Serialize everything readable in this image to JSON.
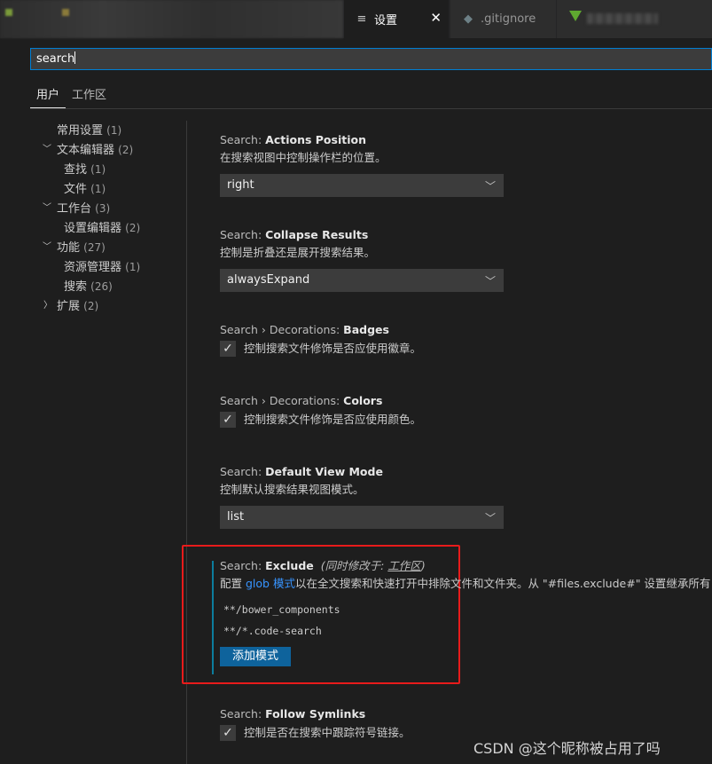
{
  "tabs": {
    "active_label": "设置",
    "inactive_label": ".gitignore",
    "close_glyph": "✕"
  },
  "search": {
    "value": "search"
  },
  "scope": {
    "user": "用户",
    "workspace": "工作区"
  },
  "toc": [
    {
      "label": "常用设置",
      "count": "(1)",
      "level": 0,
      "chevron": ""
    },
    {
      "label": "文本编辑器",
      "count": "(2)",
      "level": 0,
      "chevron": "down"
    },
    {
      "label": "查找",
      "count": "(1)",
      "level": 1,
      "chevron": ""
    },
    {
      "label": "文件",
      "count": "(1)",
      "level": 1,
      "chevron": ""
    },
    {
      "label": "工作台",
      "count": "(3)",
      "level": 0,
      "chevron": "down"
    },
    {
      "label": "设置编辑器",
      "count": "(2)",
      "level": 1,
      "chevron": ""
    },
    {
      "label": "功能",
      "count": "(27)",
      "level": 0,
      "chevron": "down"
    },
    {
      "label": "资源管理器",
      "count": "(1)",
      "level": 1,
      "chevron": ""
    },
    {
      "label": "搜索",
      "count": "(26)",
      "level": 1,
      "chevron": ""
    },
    {
      "label": "扩展",
      "count": "(2)",
      "level": 0,
      "chevron": "right"
    }
  ],
  "settings": {
    "actions_position": {
      "category": "Search: ",
      "name": "Actions Position",
      "description": "在搜索视图中控制操作栏的位置。",
      "value": "right"
    },
    "collapse_results": {
      "category": "Search: ",
      "name": "Collapse Results",
      "description": "控制是折叠还是展开搜索结果。",
      "value": "alwaysExpand"
    },
    "decorations_badges": {
      "category": "Search › Decorations: ",
      "name": "Badges",
      "description": "控制搜索文件修饰是否应使用徽章。",
      "checked": true
    },
    "decorations_colors": {
      "category": "Search › Decorations: ",
      "name": "Colors",
      "description": "控制搜索文件修饰是否应使用颜色。",
      "checked": true
    },
    "default_view_mode": {
      "category": "Search: ",
      "name": "Default View Mode",
      "description": "控制默认搜索结果视图模式。",
      "value": "list"
    },
    "exclude": {
      "category": "Search: ",
      "name": "Exclude",
      "also_modified_prefix": "(同时修改于: ",
      "also_modified_link": "工作区",
      "also_modified_suffix": ")",
      "desc_prefix": "配置 ",
      "desc_link": "glob 模式",
      "desc_suffix": "以在全文搜索和快速打开中排除文件和文件夹。从 \"#files.exclude#\" 设置继承所有",
      "patterns": [
        "**/bower_components",
        "**/*.code-search"
      ],
      "add_button": "添加模式"
    },
    "follow_symlinks": {
      "category": "Search: ",
      "name": "Follow Symlinks",
      "description": "控制是否在搜索中跟踪符号链接。",
      "checked": true
    }
  },
  "watermark": "CSDN @这个昵称被占用了吗",
  "colors": {
    "accent": "#007fd4",
    "button": "#0e639c",
    "highlight": "#e81b1b",
    "link": "#3794ff"
  }
}
